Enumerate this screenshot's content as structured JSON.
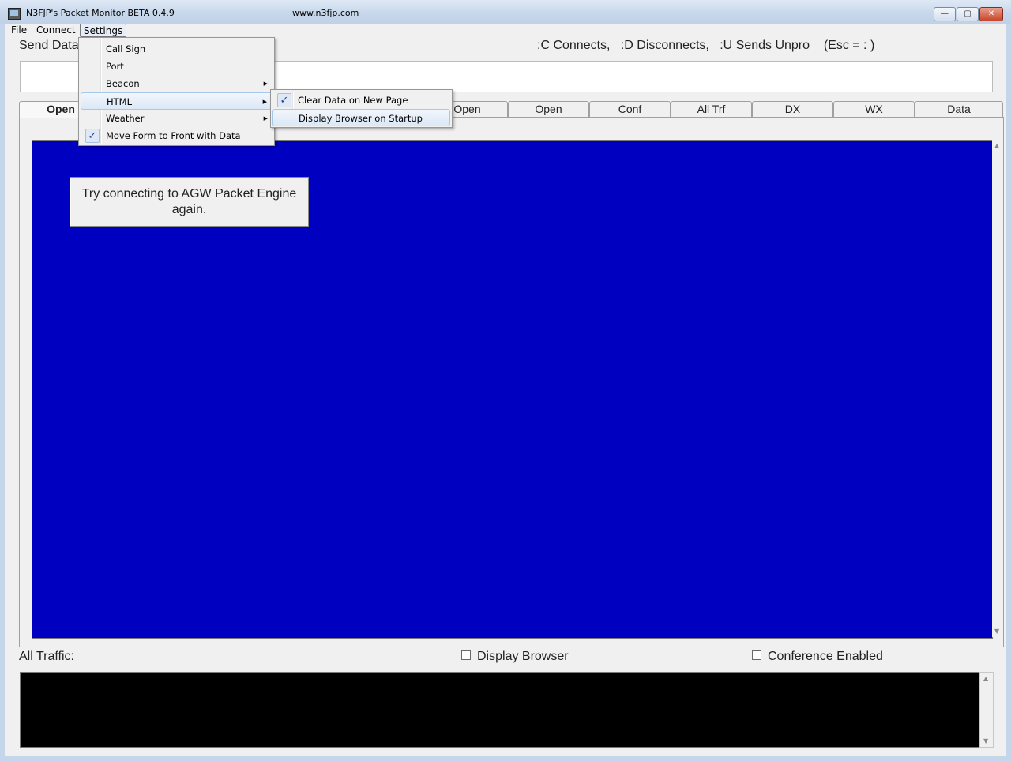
{
  "window": {
    "title": "N3FJP's Packet Monitor BETA 0.4.9",
    "url": "www.n3fjp.com",
    "controls": {
      "minimize": "▭",
      "maximize": "▣",
      "close": "✕"
    }
  },
  "menubar": {
    "file": "File",
    "connect": "Connect",
    "settings": "Settings"
  },
  "settings_menu": {
    "items": [
      {
        "label": "Call Sign"
      },
      {
        "label": "Port"
      },
      {
        "label": "Beacon",
        "submenu": true
      },
      {
        "label": "HTML",
        "submenu": true,
        "highlighted": true
      },
      {
        "label": "Weather",
        "submenu": true
      },
      {
        "label": "Move Form to Front with Data",
        "checked": true
      }
    ]
  },
  "html_submenu": {
    "items": [
      {
        "label": "Clear Data on New Page",
        "checked": true
      },
      {
        "label": "Display Browser on Startup",
        "highlighted": true
      }
    ]
  },
  "send": {
    "label": "Send Data",
    "help": ":C Connects,   :D Disconnects,   :U Sends Unpro    (Esc = : )",
    "value": ""
  },
  "tabs": [
    "Open",
    "Open",
    "Open",
    "Conf",
    "All Trf",
    "DX",
    "WX",
    "Data"
  ],
  "monitor_color": "#0000c0",
  "alert": {
    "message": "Try connecting to AGW Packet Engine again."
  },
  "bottom": {
    "all_traffic_label": "All Traffic:",
    "display_browser_label": "Display Browser",
    "display_browser_checked": false,
    "conference_label": "Conference Enabled",
    "conference_checked": false
  }
}
